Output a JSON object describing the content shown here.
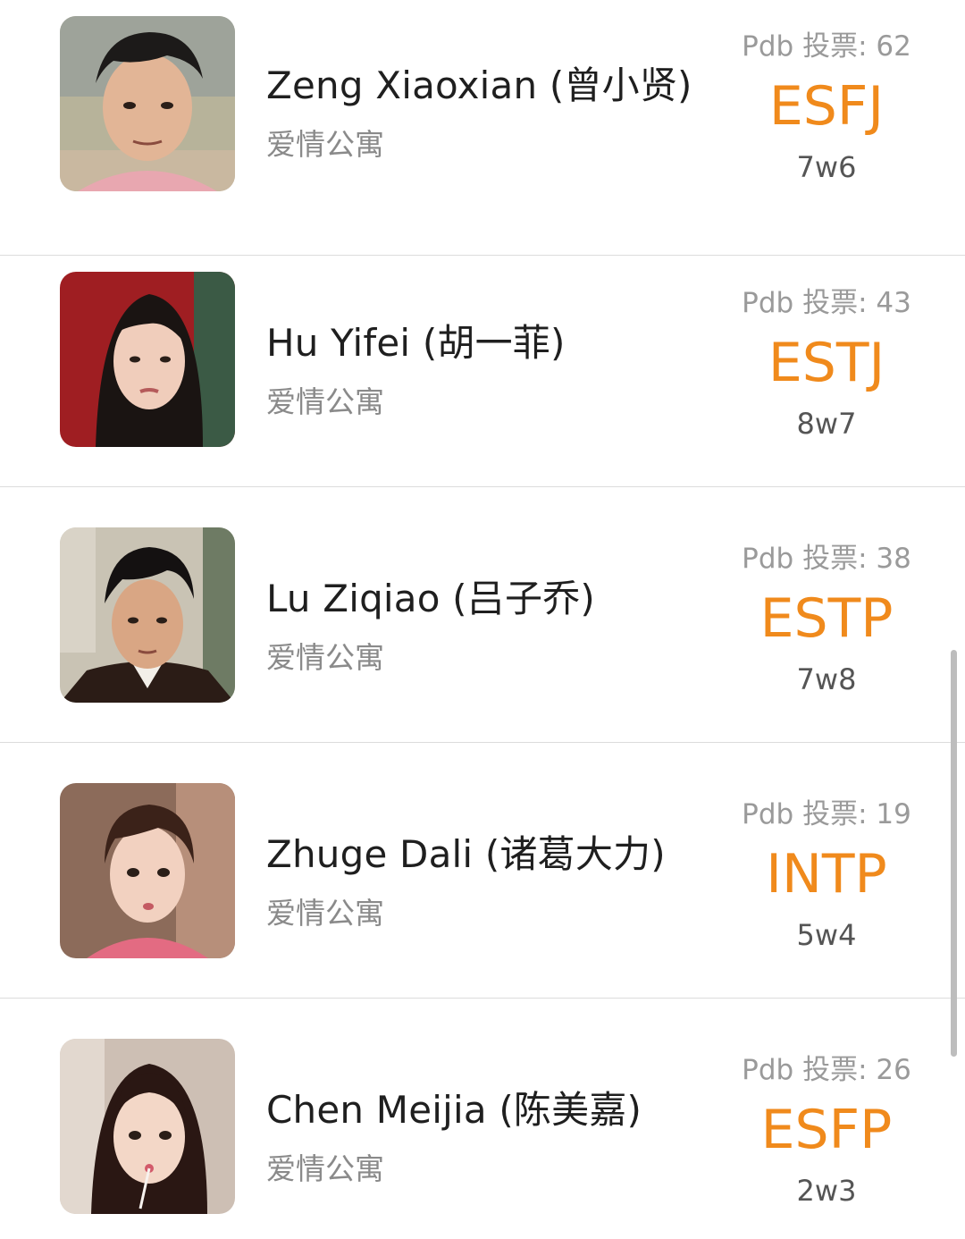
{
  "characters": [
    {
      "name": "Zeng Xiaoxian (曾小贤)",
      "show": "爱情公寓",
      "votes": "Pdb 投票: 62",
      "mbti": "ESFJ",
      "enneagram": "7w6"
    },
    {
      "name": "Hu Yifei (胡一菲)",
      "show": "爱情公寓",
      "votes": "Pdb 投票: 43",
      "mbti": "ESTJ",
      "enneagram": "8w7"
    },
    {
      "name": "Lu Ziqiao (吕子乔)",
      "show": "爱情公寓",
      "votes": "Pdb 投票: 38",
      "mbti": "ESTP",
      "enneagram": "7w8"
    },
    {
      "name": "Zhuge Dali (诸葛大力)",
      "show": "爱情公寓",
      "votes": "Pdb 投票: 19",
      "mbti": "INTP",
      "enneagram": "5w4"
    },
    {
      "name": "Chen Meijia (陈美嘉)",
      "show": "爱情公寓",
      "votes": "Pdb 投票: 26",
      "mbti": "ESFP",
      "enneagram": "2w3"
    }
  ],
  "colors": {
    "mbti_accent": "#f08a1c",
    "vote_text": "#9a9a9a",
    "divider": "#dcdcdc"
  },
  "icons": {
    "avatar": "person-photo-avatar"
  }
}
